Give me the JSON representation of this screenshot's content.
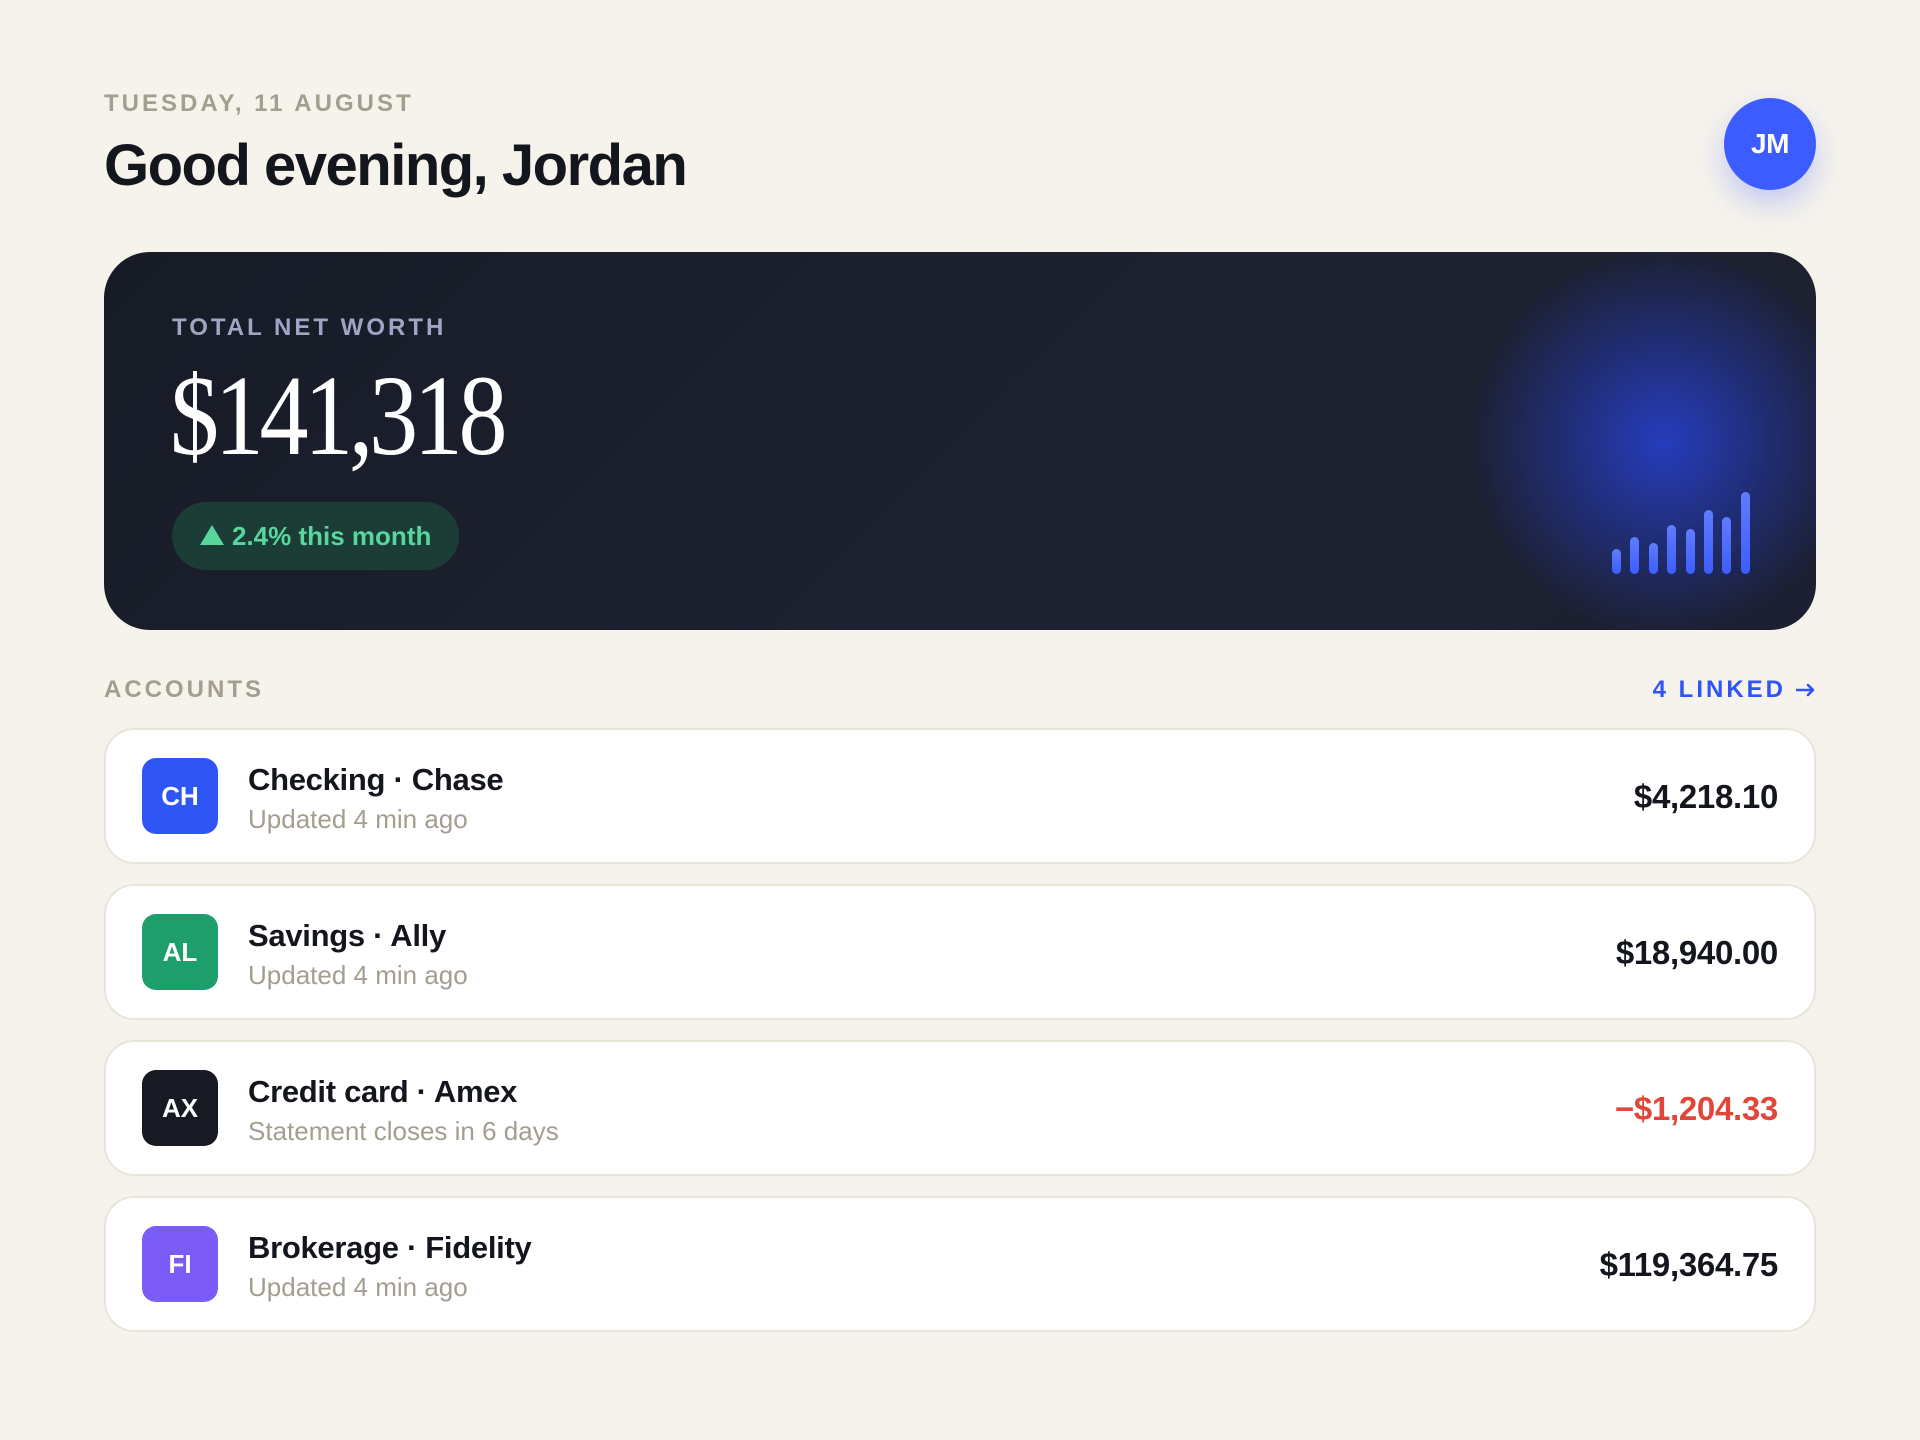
{
  "header": {
    "date": "TUESDAY, 11 AUGUST",
    "greeting": "Good evening, Jordan",
    "avatar_initials": "JM"
  },
  "net_worth": {
    "label": "TOTAL NET WORTH",
    "value": "$141,318",
    "change": "2.4% this month",
    "change_icon": "triangle-up-icon",
    "trend_bars": [
      0.3,
      0.45,
      0.38,
      0.6,
      0.55,
      0.78,
      0.7,
      1.0
    ]
  },
  "accounts": {
    "label": "ACCOUNTS",
    "linked": "4 LINKED",
    "linked_icon": "arrow-right-icon",
    "items": [
      {
        "initials": "CH",
        "color": "#2f55f4",
        "name": "Checking · Chase",
        "status": "Updated 4 min ago",
        "amount": "$4,218.10",
        "negative": false
      },
      {
        "initials": "AL",
        "color": "#1e9e6a",
        "name": "Savings · Ally",
        "status": "Updated 4 min ago",
        "amount": "$18,940.00",
        "negative": false
      },
      {
        "initials": "AX",
        "color": "#171a22",
        "name": "Credit card · Amex",
        "status": "Statement closes in 6 days",
        "amount": "−$1,204.33",
        "negative": true
      },
      {
        "initials": "FI",
        "color": "#7c5cf6",
        "name": "Brokerage · Fidelity",
        "status": "Updated 4 min ago",
        "amount": "$119,364.75",
        "negative": false
      }
    ]
  },
  "colors": {
    "background": "#f6f3ec",
    "accent": "#2e54f5",
    "positive": "#58d69e",
    "negative": "#e0463a"
  }
}
